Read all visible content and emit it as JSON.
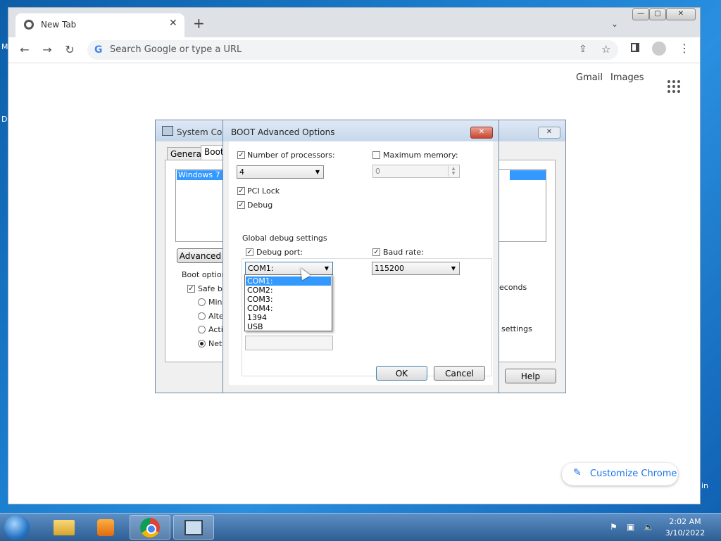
{
  "desktop": {
    "fragments": {
      "m": "M",
      "d": "D",
      "in": "in"
    }
  },
  "chrome": {
    "tab_title": "New Tab",
    "omnibox_placeholder": "Search Google or type a URL",
    "links": {
      "gmail": "Gmail",
      "images": "Images"
    },
    "customize_label": "Customize Chrome"
  },
  "system_config": {
    "title": "System Conf",
    "tabs": [
      "General",
      "Boot"
    ],
    "os_entry": "Windows 7 (C",
    "advanced_button": "Advanced o",
    "boot_options_label": "Boot options",
    "safe_boot_label": "Safe bo",
    "safe_boot_checked": true,
    "radio_items": [
      {
        "label": "Minin",
        "selected": false
      },
      {
        "label": "Alter",
        "selected": false
      },
      {
        "label": "Activ",
        "selected": false
      },
      {
        "label": "Netw",
        "selected": true
      }
    ],
    "timeout_suffix": "econds",
    "settings_suffix": "settings",
    "help_button": "Help"
  },
  "boot_advanced": {
    "title": "BOOT Advanced Options",
    "num_processors": {
      "label": "Number of processors:",
      "checked": true,
      "value": "4"
    },
    "max_memory": {
      "label": "Maximum memory:",
      "checked": false,
      "value": "0"
    },
    "pci_lock": {
      "label": "PCI Lock",
      "checked": true
    },
    "debug": {
      "label": "Debug",
      "checked": true
    },
    "global_debug_label": "Global debug settings",
    "debug_port": {
      "label": "Debug port:",
      "checked": true,
      "value": "COM1:"
    },
    "baud_rate": {
      "label": "Baud rate:",
      "checked": true,
      "value": "115200"
    },
    "debug_port_options": [
      "COM1:",
      "COM2:",
      "COM3:",
      "COM4:",
      "1394",
      "USB"
    ],
    "selected_option_index": 0,
    "ok_button": "OK",
    "cancel_button": "Cancel"
  },
  "taskbar": {
    "time": "2:02 AM",
    "date": "3/10/2022"
  }
}
